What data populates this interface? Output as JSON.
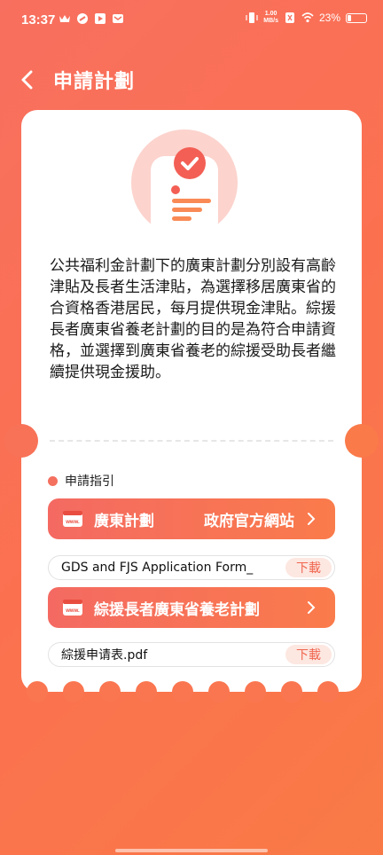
{
  "status": {
    "time": "13:37",
    "net_speed_value": "1.00",
    "net_speed_unit": "MB/s",
    "battery": "23%",
    "battery_level": 0.23
  },
  "header": {
    "title": "申請計劃"
  },
  "card": {
    "description": "公共福利金計劃下的廣東計劃分別設有高齡津貼及長者生活津貼，為選擇移居廣東省的合資格香港居民，每月提供現金津貼。綜援長者廣東省養老計劃的目的是為符合申請資格，並選擇到廣東省養老的綜援受助長者繼續提供現金援助。",
    "guide_label": "申請指引",
    "links": [
      {
        "label": "廣東計劃",
        "right_label": "政府官方網站"
      },
      {
        "label": "綜援長者廣東省養老計劃",
        "right_label": ""
      }
    ],
    "files": [
      {
        "name": "GDS and FJS Application Form_",
        "action": "下載"
      },
      {
        "name": "綜援申请表.pdf",
        "action": "下載"
      }
    ]
  },
  "colors": {
    "accent": "#f4705f",
    "download_bg": "#fde7e1",
    "download_text": "#f0664f"
  }
}
